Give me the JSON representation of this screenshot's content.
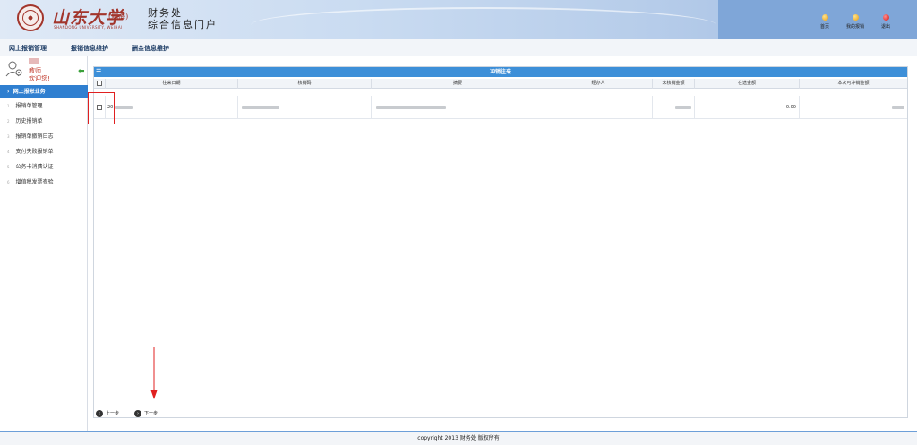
{
  "header": {
    "logo_cn": "山东大学",
    "logo_campus": "(威海)",
    "logo_en": "SHANDONG UNIVERSITY, WEIHAI",
    "portal_line1": "财务处",
    "portal_line2": "综合信息门户",
    "buttons": [
      {
        "label": "首页",
        "icon": "home-dot-icon"
      },
      {
        "label": "我的报销",
        "icon": "my-reimburse-dot-icon"
      },
      {
        "label": "退出",
        "icon": "logout-dot-icon"
      }
    ]
  },
  "nav": {
    "tabs": [
      "网上报销管理",
      "报销信息维护",
      "酬金信息维护"
    ]
  },
  "sidebar": {
    "role": "教师",
    "welcome": "欢迎您!",
    "active": "网上报帐业务",
    "items": [
      {
        "num": "1",
        "label": "报销单管理"
      },
      {
        "num": "2",
        "label": "历史报销单"
      },
      {
        "num": "3",
        "label": "报销单撤销日志"
      },
      {
        "num": "4",
        "label": "支付失败报销单"
      },
      {
        "num": "5",
        "label": "公务卡消费认证"
      },
      {
        "num": "6",
        "label": "增值税发票查验"
      }
    ]
  },
  "panel": {
    "title": "冲销往来",
    "columns": [
      "往来日期",
      "核销码",
      "摘要",
      "经办人",
      "未核销金额",
      "在途金额",
      "本次可冲销金额"
    ],
    "row": {
      "date": "20",
      "code": "",
      "summary": "",
      "handler": "",
      "unverified": "",
      "in_transit": "0.00",
      "writeoff": ""
    }
  },
  "pager": {
    "prev": "上一步",
    "next": "下一步"
  },
  "footer": {
    "copyright": "copyright 2013 财务处 版权所有"
  },
  "colors": {
    "header_accent": "#7fa6d8",
    "sidebar_active": "#2f7fd0",
    "panel_head": "#3d8fd8",
    "brand_red": "#a2352c",
    "highlight": "#e02020"
  }
}
